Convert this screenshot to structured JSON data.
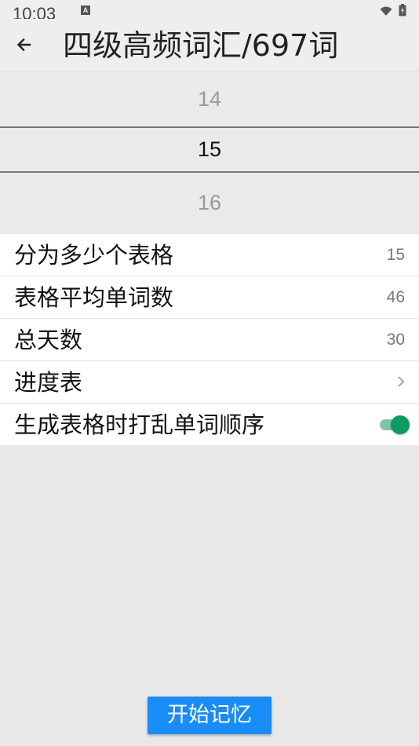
{
  "status_bar": {
    "time": "10:03",
    "notification_icon": "a-icon",
    "wifi_icon": "wifi-icon",
    "battery_icon": "battery-icon"
  },
  "header": {
    "back_icon": "arrow-left-icon",
    "title": "四级高频词汇/697词"
  },
  "picker": {
    "prev": "14",
    "selected": "15",
    "next": "16"
  },
  "settings": {
    "tables_count": {
      "label": "分为多少个表格",
      "value": "15"
    },
    "avg_words": {
      "label": "表格平均单词数",
      "value": "46"
    },
    "total_days": {
      "label": "总天数",
      "value": "30"
    },
    "schedule": {
      "label": "进度表",
      "icon": "chevron-right-icon"
    },
    "shuffle": {
      "label": "生成表格时打乱单词顺序",
      "enabled": true
    }
  },
  "actions": {
    "start_label": "开始记忆"
  },
  "colors": {
    "accent": "#1a8cf7",
    "toggle_on": "#0f9a63",
    "background": "#e8e8e8"
  }
}
